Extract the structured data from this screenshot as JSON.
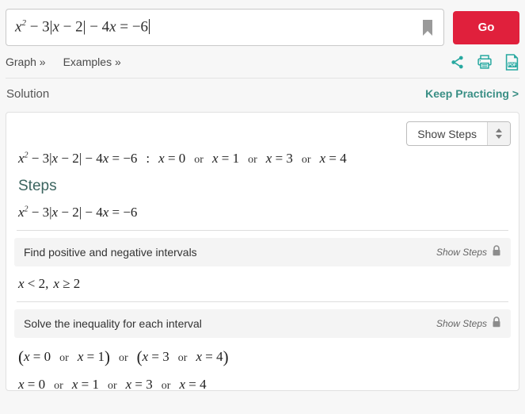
{
  "search": {
    "equation_html": "x<sup>2</sup> &#8722; 3|x &#8722; 2| &#8722; 4x = &#8722;6",
    "equation_plain": "x^2 - 3|x - 2| - 4x = -6",
    "bookmark_icon": "bookmark-icon",
    "go_label": "Go",
    "go_color": "#e0203c"
  },
  "toolbar": {
    "links": [
      {
        "label": "Graph »"
      },
      {
        "label": "Examples »"
      }
    ],
    "icons": [
      {
        "name": "share-icon"
      },
      {
        "name": "print-icon"
      },
      {
        "name": "pdf-icon"
      }
    ],
    "icon_color": "#27a8a0"
  },
  "solution_header": {
    "title": "Solution",
    "keep_practicing_label": "Keep Practicing >",
    "keep_practicing_color": "#3a8f85"
  },
  "card": {
    "steps_select": {
      "value": "Show Steps",
      "spinner_icon": "updown-spinner-icon"
    },
    "result": {
      "equation": "x² − 3|x − 2| − 4x = −6",
      "separator": ":",
      "solutions": [
        "x = 0",
        "x = 1",
        "x = 3",
        "x = 4"
      ],
      "conjunction": "or"
    },
    "steps_heading": "Steps",
    "main_equation": "x² − 3|x − 2| − 4x = −6",
    "step_panels": [
      {
        "title": "Find positive and negative intervals",
        "show_steps_label": "Show Steps",
        "lock_icon": "lock-icon",
        "result": "x < 2,  x ≥ 2"
      },
      {
        "title": "Solve the inequality for each interval",
        "show_steps_label": "Show Steps",
        "lock_icon": "lock-icon",
        "grouped_answer": "(x = 0  or  x = 1)  or  (x = 3  or  x = 4)",
        "final_answer": "x = 0  or  x = 1  or  x = 3  or  x = 4"
      }
    ]
  }
}
